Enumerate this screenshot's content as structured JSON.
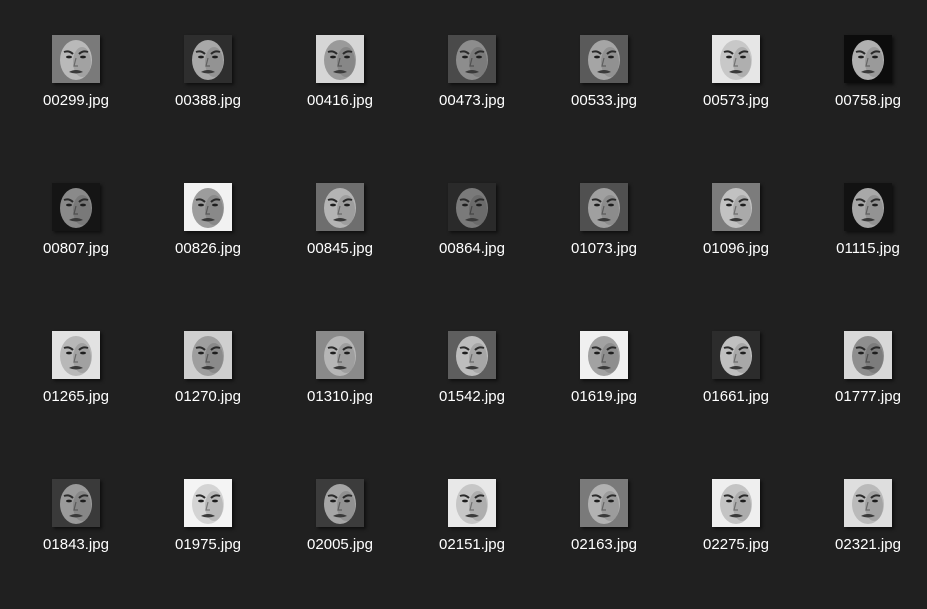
{
  "files": [
    {
      "name": "00299.jpg",
      "icon": "face-thumbnail-icon",
      "tone": "#b9b9b9",
      "bg": "#7a7a7a"
    },
    {
      "name": "00388.jpg",
      "icon": "face-thumbnail-icon",
      "tone": "#a8a8a8",
      "bg": "#2e2e2e"
    },
    {
      "name": "00416.jpg",
      "icon": "face-thumbnail-icon",
      "tone": "#9a9a9a",
      "bg": "#d6d6d6"
    },
    {
      "name": "00473.jpg",
      "icon": "face-thumbnail-icon",
      "tone": "#8d8d8d",
      "bg": "#4a4a4a"
    },
    {
      "name": "00533.jpg",
      "icon": "face-thumbnail-icon",
      "tone": "#a5a5a5",
      "bg": "#5a5a5a"
    },
    {
      "name": "00573.jpg",
      "icon": "face-thumbnail-icon",
      "tone": "#c8c8c8",
      "bg": "#e6e6e6"
    },
    {
      "name": "00758.jpg",
      "icon": "face-thumbnail-icon",
      "tone": "#b0b0b0",
      "bg": "#0c0c0c"
    },
    {
      "name": "00807.jpg",
      "icon": "face-thumbnail-icon",
      "tone": "#8a8a8a",
      "bg": "#151515"
    },
    {
      "name": "00826.jpg",
      "icon": "face-thumbnail-icon",
      "tone": "#9c9c9c",
      "bg": "#f2f2f2"
    },
    {
      "name": "00845.jpg",
      "icon": "face-thumbnail-icon",
      "tone": "#b4b4b4",
      "bg": "#6e6e6e"
    },
    {
      "name": "00864.jpg",
      "icon": "face-thumbnail-icon",
      "tone": "#7a7a7a",
      "bg": "#2a2a2a"
    },
    {
      "name": "01073.jpg",
      "icon": "face-thumbnail-icon",
      "tone": "#a0a0a0",
      "bg": "#505050"
    },
    {
      "name": "01096.jpg",
      "icon": "face-thumbnail-icon",
      "tone": "#c2c2c2",
      "bg": "#7c7c7c"
    },
    {
      "name": "01115.jpg",
      "icon": "face-thumbnail-icon",
      "tone": "#a8a8a8",
      "bg": "#121212"
    },
    {
      "name": "01265.jpg",
      "icon": "face-thumbnail-icon",
      "tone": "#b8b8b8",
      "bg": "#e2e2e2"
    },
    {
      "name": "01270.jpg",
      "icon": "face-thumbnail-icon",
      "tone": "#9e9e9e",
      "bg": "#cfcfcf"
    },
    {
      "name": "01310.jpg",
      "icon": "face-thumbnail-icon",
      "tone": "#b6b6b6",
      "bg": "#8a8a8a"
    },
    {
      "name": "01542.jpg",
      "icon": "face-thumbnail-icon",
      "tone": "#bdbdbd",
      "bg": "#5e5e5e"
    },
    {
      "name": "01619.jpg",
      "icon": "face-thumbnail-icon",
      "tone": "#a2a2a2",
      "bg": "#f0f0f0"
    },
    {
      "name": "01661.jpg",
      "icon": "face-thumbnail-icon",
      "tone": "#c0c0c0",
      "bg": "#2c2c2c"
    },
    {
      "name": "01777.jpg",
      "icon": "face-thumbnail-icon",
      "tone": "#8e8e8e",
      "bg": "#d8d8d8"
    },
    {
      "name": "01843.jpg",
      "icon": "face-thumbnail-icon",
      "tone": "#9a9a9a",
      "bg": "#3a3a3a"
    },
    {
      "name": "01975.jpg",
      "icon": "face-thumbnail-icon",
      "tone": "#d4d4d4",
      "bg": "#f4f4f4"
    },
    {
      "name": "02005.jpg",
      "icon": "face-thumbnail-icon",
      "tone": "#a6a6a6",
      "bg": "#3c3c3c"
    },
    {
      "name": "02151.jpg",
      "icon": "face-thumbnail-icon",
      "tone": "#c6c6c6",
      "bg": "#e8e8e8"
    },
    {
      "name": "02163.jpg",
      "icon": "face-thumbnail-icon",
      "tone": "#b2b2b2",
      "bg": "#7a7a7a"
    },
    {
      "name": "02275.jpg",
      "icon": "face-thumbnail-icon",
      "tone": "#c4c4c4",
      "bg": "#efefef"
    },
    {
      "name": "02321.jpg",
      "icon": "face-thumbnail-icon",
      "tone": "#bababa",
      "bg": "#dedede"
    }
  ]
}
